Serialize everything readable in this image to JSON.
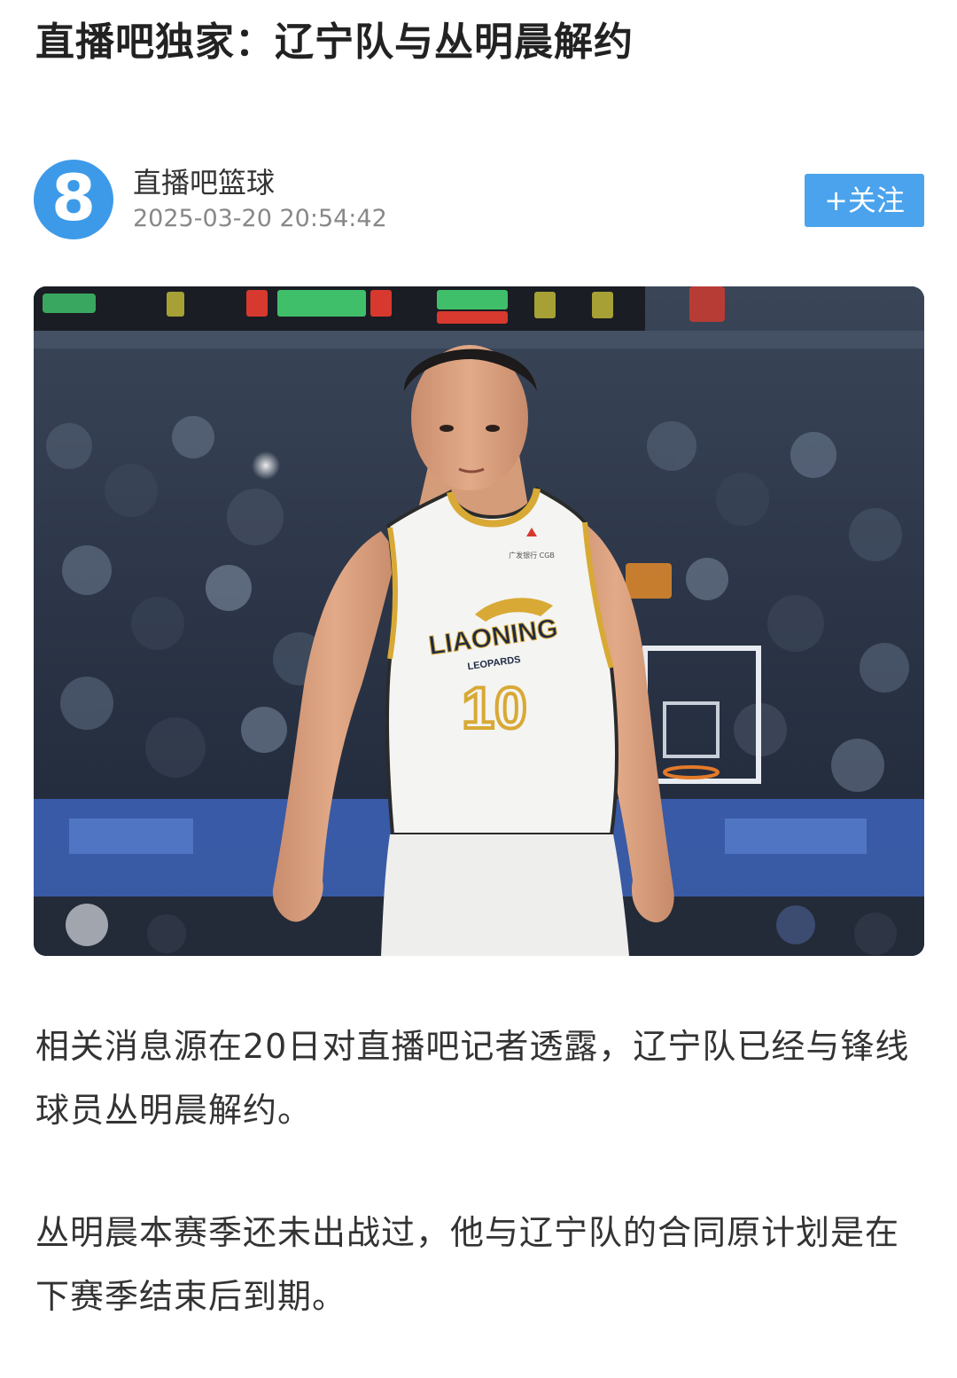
{
  "article": {
    "title": "直播吧独家：辽宁队与丛明晨解约",
    "paragraphs": [
      "相关消息源在20日对直播吧记者透露，辽宁队已经与锋线球员丛明晨解约。",
      "丛明晨本赛季还未出战过，他与辽宁队的合同原计划是在下赛季结束后到期。"
    ]
  },
  "author": {
    "avatar_glyph": "8",
    "name": "直播吧篮球",
    "publish_time": "2025-03-20 20:54:42",
    "follow_label": "+关注"
  },
  "photo": {
    "jersey_team": "LIAONING",
    "jersey_sub": "LEOPARDS",
    "jersey_number": "10",
    "jersey_sponsor": "广发银行 CGB"
  },
  "colors": {
    "accent": "#4aa3ec",
    "avatar": "#3d9ae8",
    "jersey_trim": "#d8a935"
  }
}
